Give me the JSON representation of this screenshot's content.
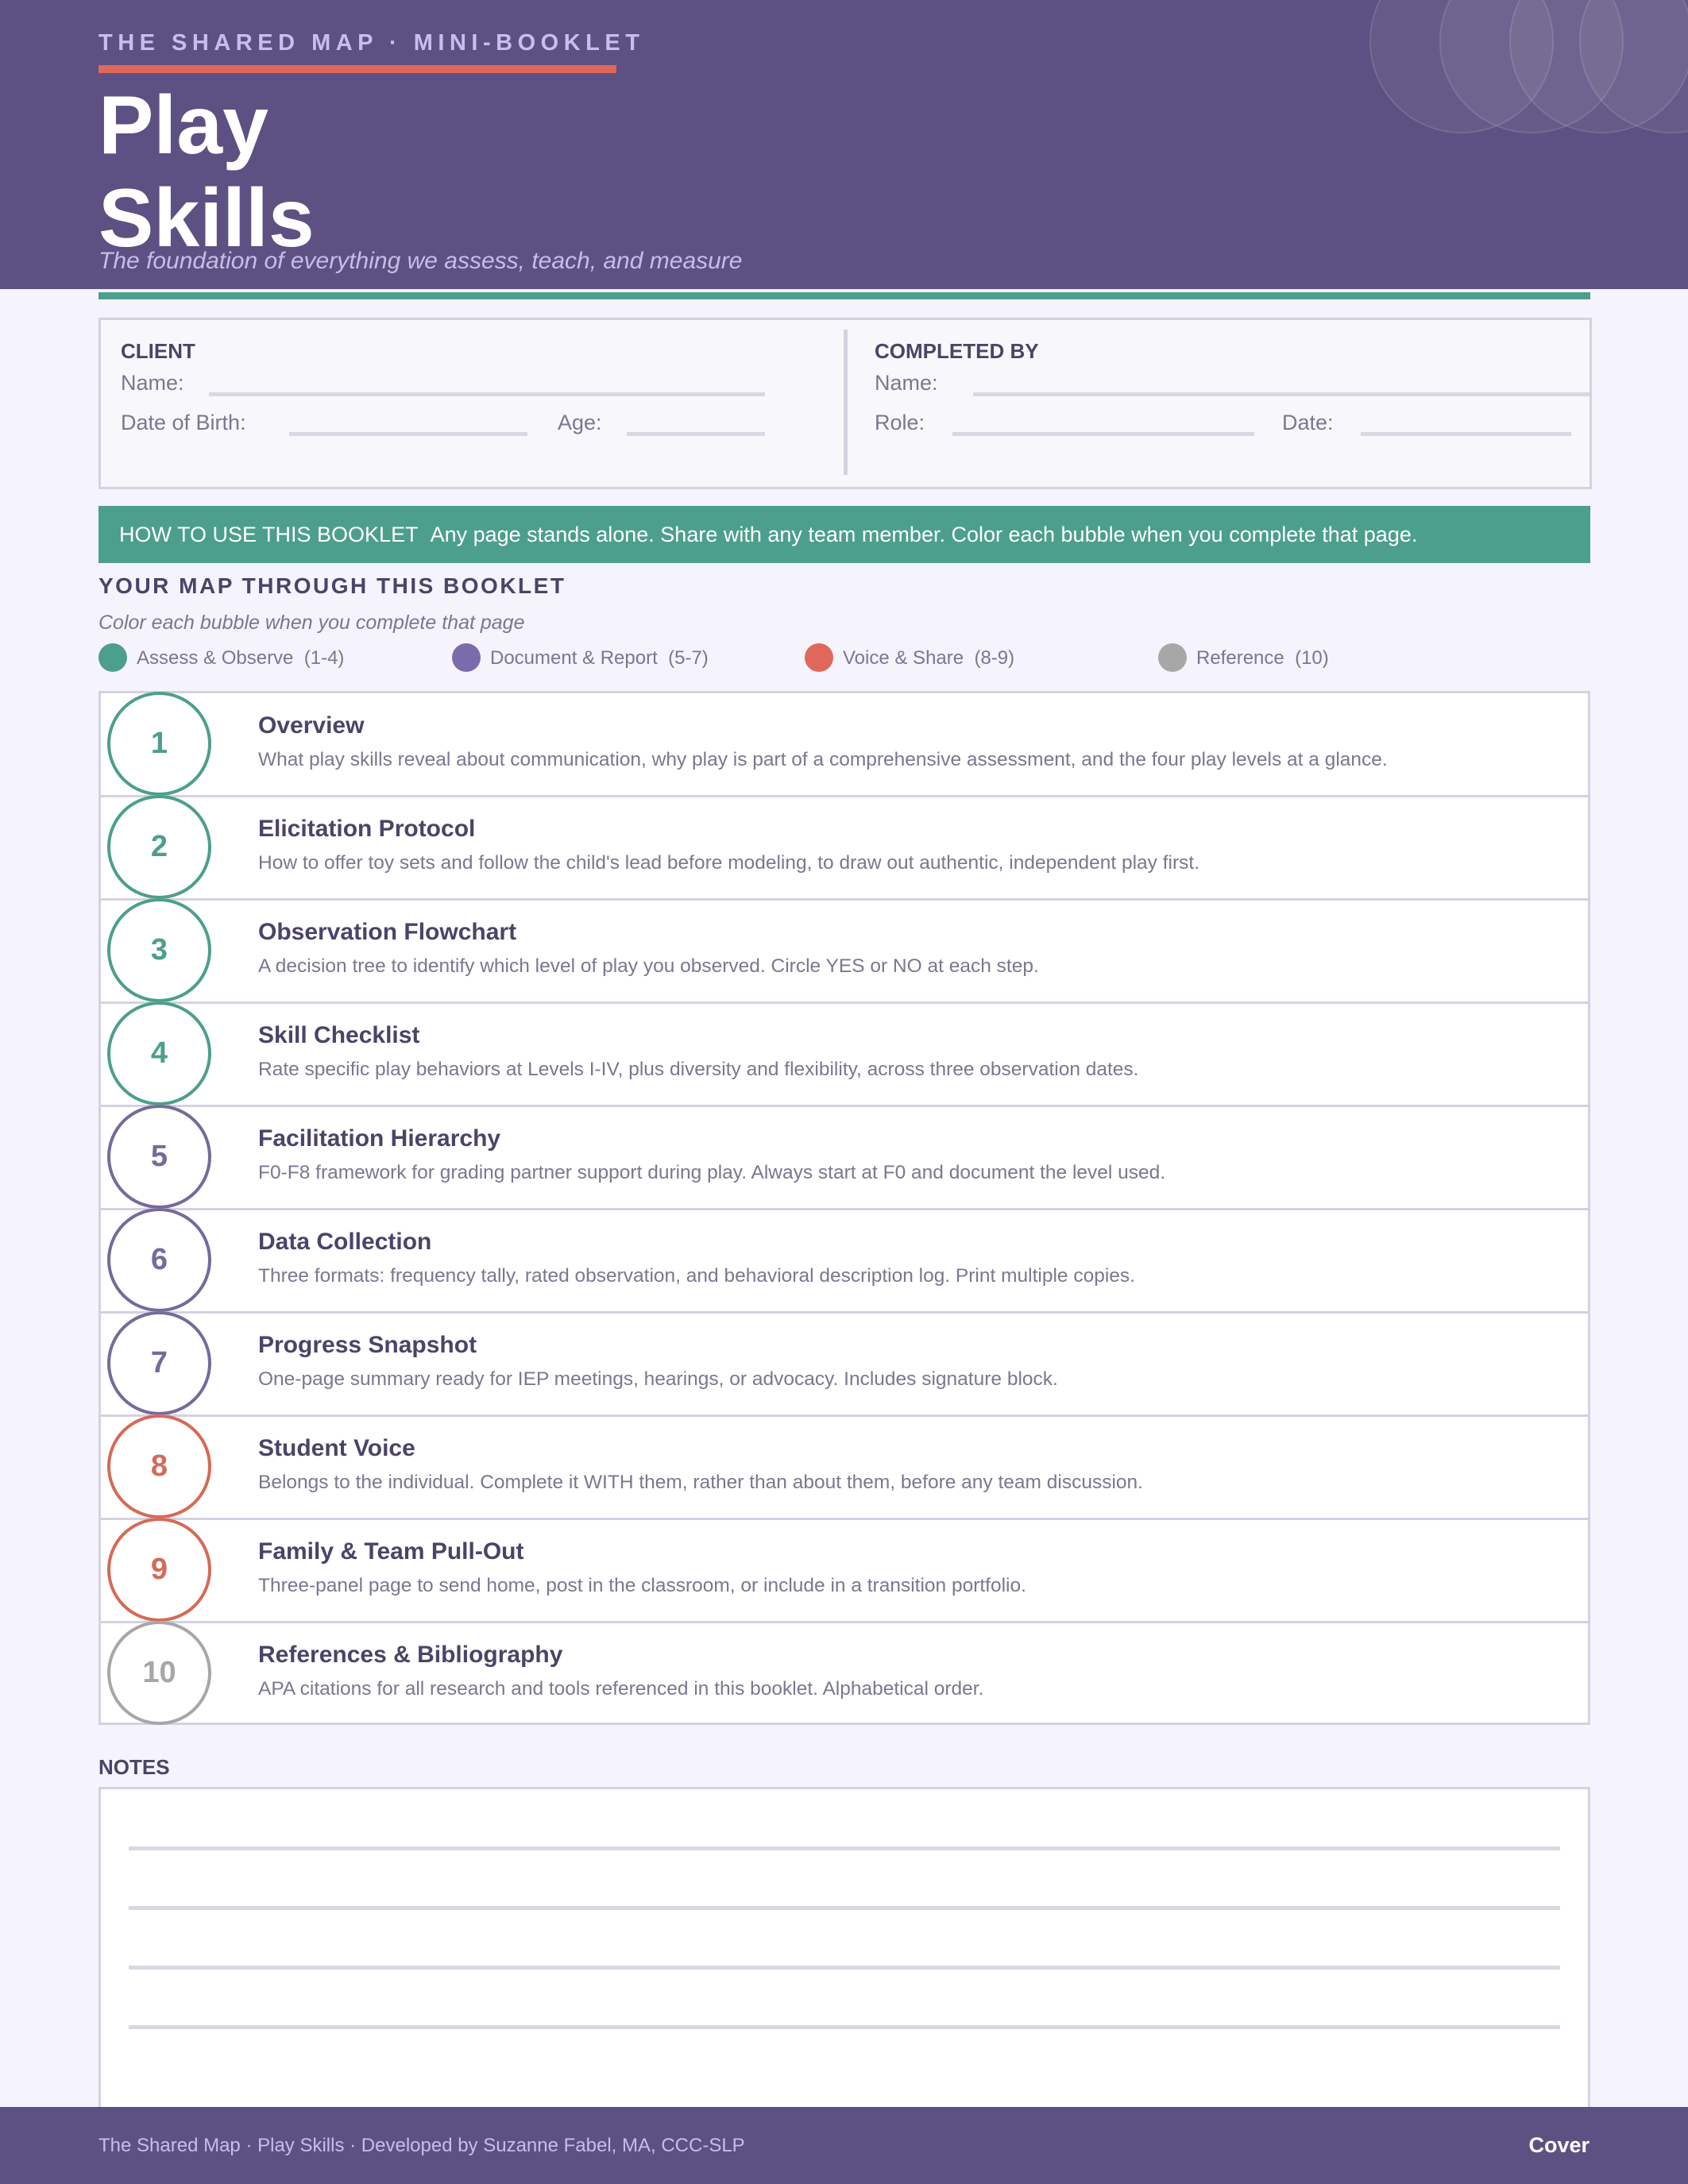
{
  "header": {
    "kicker": "THE SHARED MAP  ·  MINI-BOOKLET",
    "title_line1": "Play",
    "title_line2": "Skills",
    "subtitle": "The foundation of everything we assess, teach, and measure"
  },
  "client": {
    "heading": "CLIENT",
    "name_label": "Name:",
    "dob_label": "Date of Birth:",
    "age_label": "Age:"
  },
  "completed_by": {
    "heading": "COMPLETED BY",
    "name_label": "Name:",
    "role_label": "Role:",
    "date_label": "Date:"
  },
  "banner": {
    "lead": "HOW TO USE THIS BOOKLET",
    "text": "Any page stands alone. Share with any team member. Color each bubble when you complete that page."
  },
  "map": {
    "title": "YOUR MAP THROUGH THIS BOOKLET",
    "subtitle": "Color each bubble when you complete that page",
    "legend": [
      {
        "label": "Assess & Observe",
        "range": "(1-4)",
        "color": "#4c9f8c"
      },
      {
        "label": "Document & Report",
        "range": "(5-7)",
        "color": "#7a6cab"
      },
      {
        "label": "Voice & Share",
        "range": "(8-9)",
        "color": "#e0685a"
      },
      {
        "label": "Reference",
        "range": "(10)",
        "color": "#a7a7a7"
      }
    ],
    "items": [
      {
        "number": "1",
        "title": "Overview",
        "description": "What play skills reveal about communication, why play is part of a comprehensive assessment, and the four play levels at a glance.",
        "color": "#4c9f8c"
      },
      {
        "number": "2",
        "title": "Elicitation Protocol",
        "description": "How to offer toy sets and follow the child's lead before modeling, to draw out authentic, independent play first.",
        "color": "#4c9f8c"
      },
      {
        "number": "3",
        "title": "Observation Flowchart",
        "description": "A decision tree to identify which level of play you observed. Circle YES or NO at each step.",
        "color": "#4c9f8c"
      },
      {
        "number": "4",
        "title": "Skill Checklist",
        "description": "Rate specific play behaviors at Levels I-IV, plus diversity and flexibility, across three observation dates.",
        "color": "#4c9f8c"
      },
      {
        "number": "5",
        "title": "Facilitation Hierarchy",
        "description": "F0-F8 framework for grading partner support during play. Always start at F0 and document the level used.",
        "color": "#766a9c"
      },
      {
        "number": "6",
        "title": "Data Collection",
        "description": "Three formats: frequency tally, rated observation, and behavioral description log. Print multiple copies.",
        "color": "#766a9c"
      },
      {
        "number": "7",
        "title": "Progress Snapshot",
        "description": "One-page summary ready for IEP meetings, hearings, or advocacy. Includes signature block.",
        "color": "#766a9c"
      },
      {
        "number": "8",
        "title": "Student Voice",
        "description": "Belongs to the individual. Complete it WITH them, rather than about them, before any team discussion.",
        "color": "#d56a58"
      },
      {
        "number": "9",
        "title": "Family & Team Pull-Out",
        "description": "Three-panel page to send home, post in the classroom, or include in a transition portfolio.",
        "color": "#d56a58"
      },
      {
        "number": "10",
        "title": "References & Bibliography",
        "description": "APA citations for all research and tools referenced in this booklet. Alphabetical order.",
        "color": "#a7a7a7"
      }
    ]
  },
  "notes": {
    "heading": "NOTES"
  },
  "footer": {
    "text": "The Shared Map · Play Skills · Developed by Suzanne Fabel, MA, CCC-SLP",
    "page_label": "Cover"
  }
}
